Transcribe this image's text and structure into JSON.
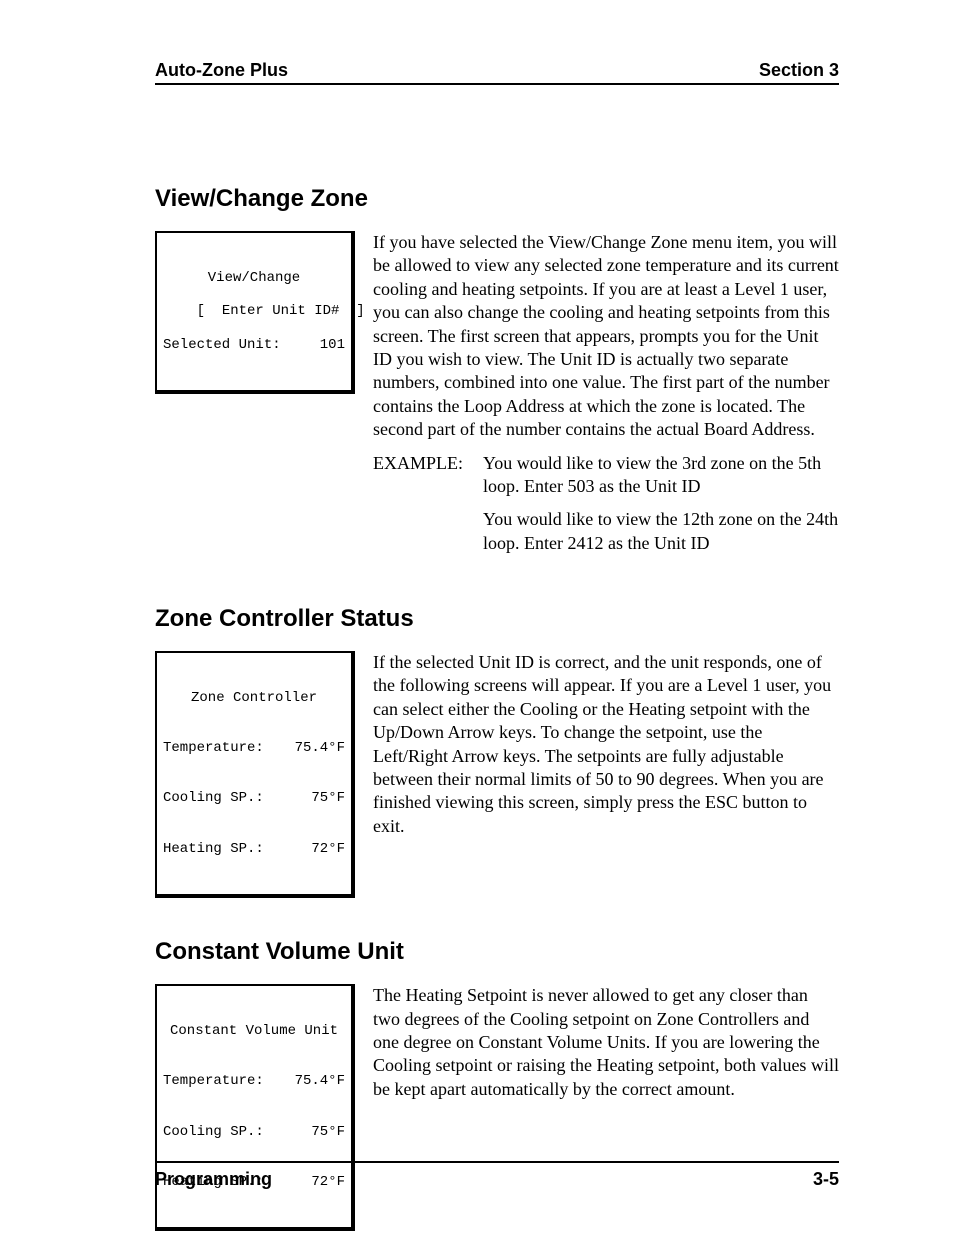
{
  "header": {
    "left": "Auto-Zone Plus",
    "right": "Section 3"
  },
  "sections": {
    "viewChange": {
      "heading": "View/Change Zone",
      "screen": {
        "title": "View/Change",
        "line2": "[  Enter Unit ID#  ]",
        "line3_label": "Selected Unit:",
        "line3_value": "101"
      },
      "body": "If you have selected the View/Change Zone menu item, you will be allowed to view any selected zone temperature and its current cooling and heating setpoints. If you are at least a Level 1 user, you can also change the cooling and heating setpoints from this screen. The first screen that appears, prompts you for the Unit ID you wish to view. The Unit ID is actually two separate numbers, combined into one value. The first part of the number contains the Loop Address at which the zone is located. The second part of the number contains the actual Board Address.",
      "example_label": "EXAMPLE:",
      "example1": "You would like to view the 3rd zone on the 5th loop. Enter 503 as the Unit ID",
      "example2": "You would like to view the 12th zone on the 24th loop. Enter 2412 as the Unit ID"
    },
    "zoneController": {
      "heading": "Zone Controller Status",
      "screen": {
        "title": "Zone Controller",
        "rows": [
          {
            "label": "Temperature:",
            "value": "75.4°F"
          },
          {
            "label": "Cooling SP.:",
            "value": "75°F"
          },
          {
            "label": "Heating SP.:",
            "value": "72°F"
          }
        ]
      },
      "body": "If the selected Unit ID is correct, and the unit responds, one of the following screens will appear. If you are a Level 1 user, you can select either the Cooling or the Heating setpoint with the Up/Down Arrow keys. To change the setpoint, use the Left/Right Arrow keys. The setpoints are fully adjustable between their normal limits of 50 to 90 degrees. When you are finished viewing this screen, simply press the ESC button to exit."
    },
    "constantVolume": {
      "heading": "Constant Volume Unit",
      "screen": {
        "title": "Constant Volume Unit",
        "rows": [
          {
            "label": "Temperature:",
            "value": "75.4°F"
          },
          {
            "label": "Cooling SP.:",
            "value": "75°F"
          },
          {
            "label": "Heating SP.:",
            "value": "72°F"
          }
        ]
      },
      "body": "The Heating Setpoint is never allowed to get any closer than two degrees of the Cooling setpoint on Zone Controllers and one degree on Constant Volume Units. If you are lowering the Cooling setpoint or raising the Heating setpoint, both values will be kept apart automatically by the correct amount."
    }
  },
  "footer": {
    "left": "Programming",
    "right": "3-5"
  }
}
